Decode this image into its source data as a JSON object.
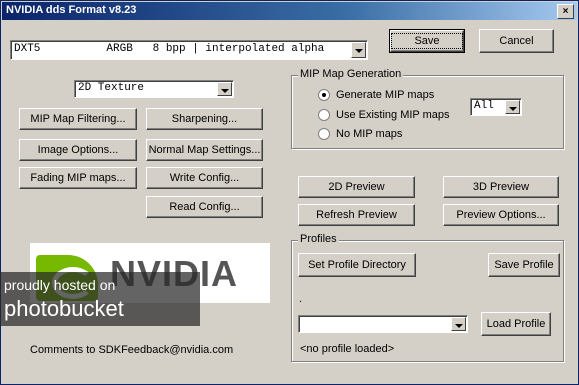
{
  "window": {
    "title": "NVIDIA dds Format v8.23",
    "close_glyph": "×"
  },
  "format": {
    "selected": "DXT5          ARGB   8 bpp | interpolated alpha"
  },
  "texture_type": {
    "selected": "2D Texture"
  },
  "buttons": {
    "save": "Save",
    "cancel": "Cancel",
    "mip_map_filtering": "MIP Map Filtering...",
    "sharpening": "Sharpening...",
    "image_options": "Image Options...",
    "normal_map_settings": "Normal Map Settings...",
    "fading_mip_maps": "Fading MIP maps...",
    "write_config": "Write Config...",
    "read_config": "Read Config...",
    "preview_2d": "2D Preview",
    "preview_3d": "3D Preview",
    "refresh_preview": "Refresh Preview",
    "preview_options": "Preview Options...",
    "set_profile_directory": "Set Profile Directory",
    "save_profile": "Save Profile",
    "load_profile": "Load Profile"
  },
  "mip_generation": {
    "title": "MIP Map Generation",
    "options": [
      "Generate MIP maps",
      "Use Existing MIP maps",
      "No MIP maps"
    ],
    "selected_index": 0,
    "count_selected": "All"
  },
  "profiles": {
    "title": "Profiles",
    "directory_text": ".",
    "combo_value": "",
    "status": "<no profile loaded>"
  },
  "logo": {
    "text": "NVIDIA"
  },
  "watermark": {
    "line1": "proudly hosted on",
    "line2": "photobucket"
  },
  "footer": {
    "comments": "Comments to SDKFeedback@nvidia.com"
  }
}
